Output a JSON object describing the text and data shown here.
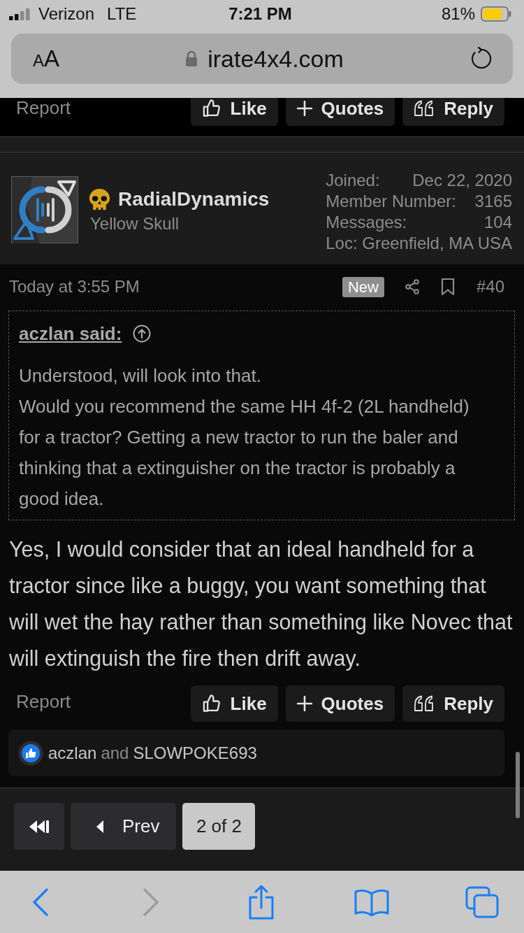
{
  "status_bar": {
    "carrier": "Verizon",
    "network": "LTE",
    "time": "7:21 PM",
    "battery": "81%"
  },
  "browser": {
    "text_size_label": "AA",
    "domain": "irate4x4.com"
  },
  "previous_post": {
    "report": "Report",
    "actions": [
      {
        "kind": "like",
        "label": "Like"
      },
      {
        "kind": "quotes",
        "label": "Quotes"
      },
      {
        "kind": "reply",
        "label": "Reply"
      }
    ]
  },
  "post": {
    "author": {
      "name": "RadialDynamics",
      "title": "Yellow Skull",
      "stats": [
        {
          "label": "Joined:",
          "value": "Dec 22, 2020"
        },
        {
          "label": "Member Number:",
          "value": "3165"
        },
        {
          "label": "Messages:",
          "value": "104"
        }
      ],
      "location": "Loc: Greenfield, MA USA"
    },
    "time": "Today at 3:55 PM",
    "badge": "New",
    "number": "#40",
    "quote": {
      "author": "aczlan said:",
      "paragraphs": [
        "Understood, will look into that.",
        "Would you recommend the same HH 4f-2 (2L handheld) for a tractor? Getting a new tractor to run the baler and thinking that a extinguisher on the tractor is probably a good idea."
      ]
    },
    "body": "Yes, I would consider that an ideal handheld for a tractor since like a buggy, you want something that will wet the hay rather than something like Novec that will extinguish the fire then drift away.",
    "report": "Report",
    "actions": [
      {
        "kind": "like",
        "label": "Like"
      },
      {
        "kind": "quotes",
        "label": "Quotes"
      },
      {
        "kind": "reply",
        "label": "Reply"
      }
    ],
    "reactions": {
      "users": [
        "aczlan",
        "SLOWPOKE693"
      ],
      "joiner": "and"
    }
  },
  "pagination": [
    {
      "kind": "first",
      "selected": false
    },
    {
      "kind": "prev",
      "label": "Prev",
      "selected": false
    },
    {
      "kind": "page",
      "label": "2 of 2",
      "selected": true
    }
  ],
  "toolbar": [
    {
      "kind": "back",
      "disabled": false
    },
    {
      "kind": "forward",
      "disabled": true
    },
    {
      "kind": "share",
      "disabled": false
    },
    {
      "kind": "bookmarks",
      "disabled": false
    },
    {
      "kind": "tabs",
      "disabled": false
    }
  ]
}
